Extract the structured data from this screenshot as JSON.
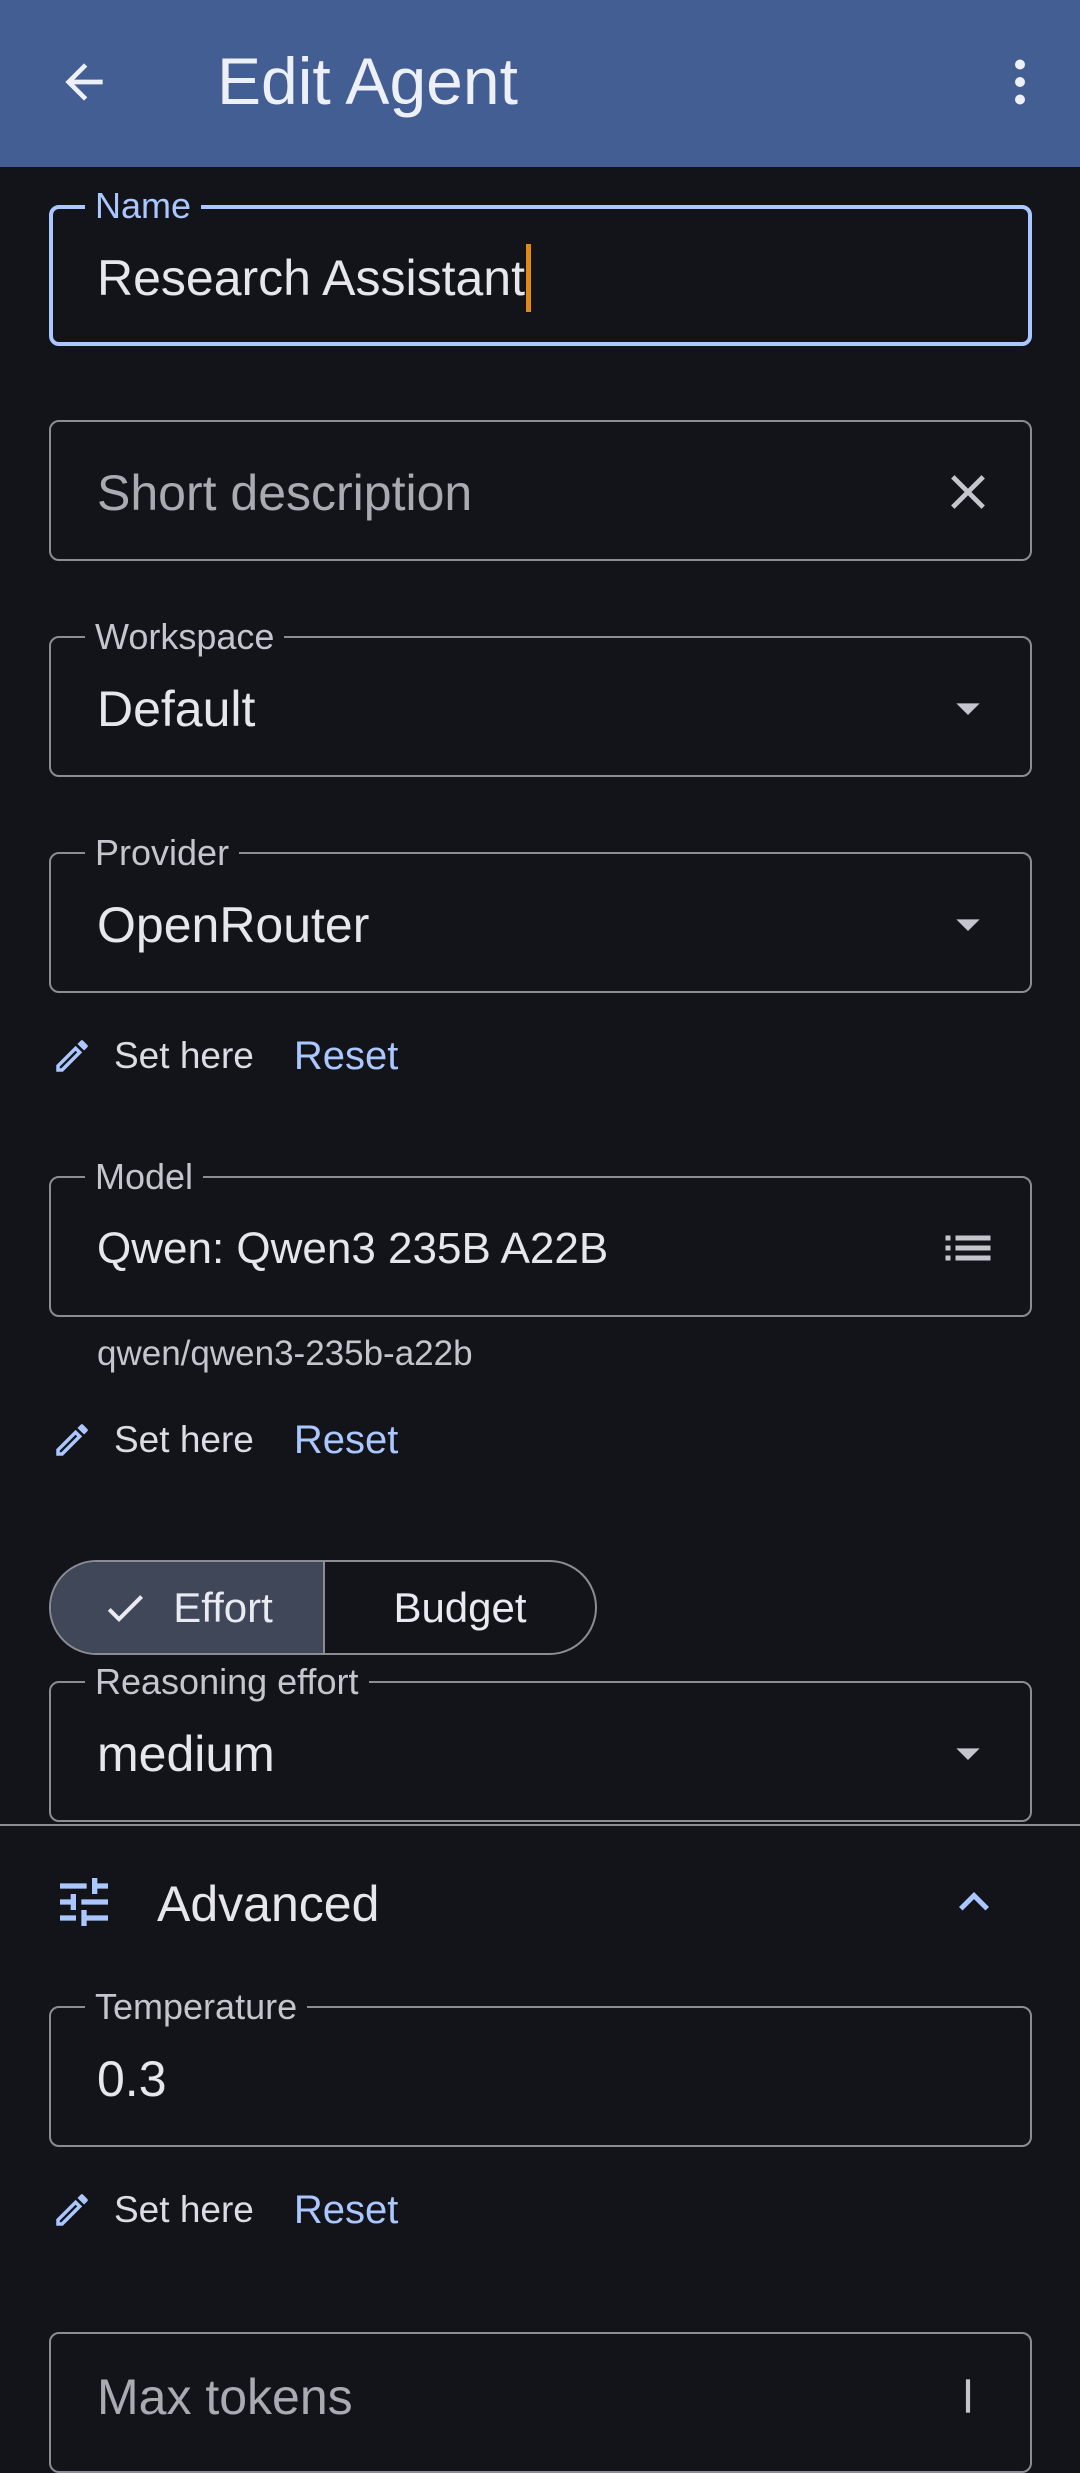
{
  "appbar": {
    "title": "Edit Agent",
    "back_icon": "arrow-back-icon",
    "more_icon": "more-vert-icon"
  },
  "fields": {
    "name": {
      "label": "Name",
      "value": "Research Assistant"
    },
    "description": {
      "placeholder": "Short description",
      "clear_icon": "close-icon"
    },
    "workspace": {
      "label": "Workspace",
      "value": "Default"
    },
    "provider": {
      "label": "Provider",
      "value": "OpenRouter"
    },
    "model": {
      "label": "Model",
      "value": "Qwen: Qwen3 235B A22B",
      "helper": "qwen/qwen3-235b-a22b",
      "icon": "list-icon"
    },
    "reasoning": {
      "label": "Reasoning effort",
      "value": "medium"
    },
    "temperature": {
      "label": "Temperature",
      "value": "0.3"
    },
    "max_tokens": {
      "label": "Max tokens"
    }
  },
  "overrides": {
    "set_here": "Set here",
    "reset": "Reset"
  },
  "segmented": {
    "effort": "Effort",
    "budget": "Budget",
    "selected": "Effort"
  },
  "advanced": {
    "label": "Advanced",
    "expanded": true
  },
  "colors": {
    "appbar": "#425e92",
    "background": "#131419",
    "accent": "#aac7ff",
    "caret": "#e08a16",
    "outline": "#8b8c94"
  }
}
